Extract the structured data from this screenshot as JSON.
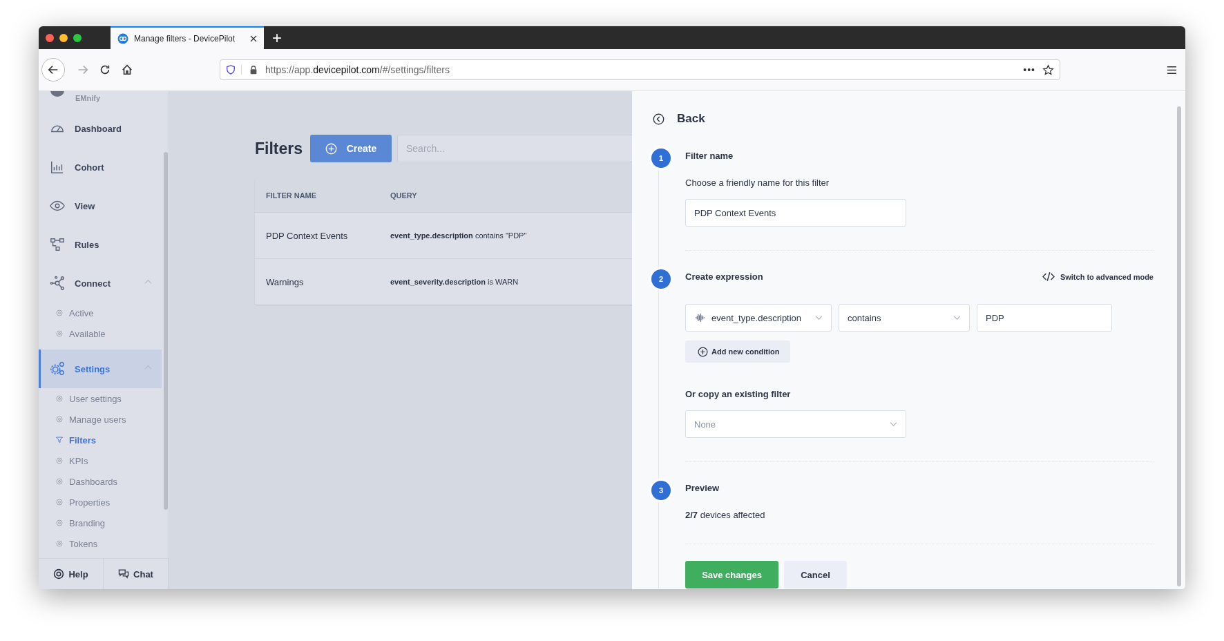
{
  "browser": {
    "tab_title": "Manage filters - DevicePilot",
    "new_tab": "+",
    "url": {
      "prefix": "https://app.",
      "domain": "devicepilot.com",
      "path": "/#/settings/filters"
    },
    "page_actions": "•••"
  },
  "sidebar": {
    "account": "EMnify",
    "items": [
      {
        "label": "Dashboard",
        "selected": false
      },
      {
        "label": "Cohort",
        "selected": false
      },
      {
        "label": "View",
        "selected": false
      },
      {
        "label": "Rules",
        "selected": false
      },
      {
        "label": "Connect",
        "selected": false,
        "expanded": true,
        "children": [
          {
            "label": "Active",
            "selected": false
          },
          {
            "label": "Available",
            "selected": false
          }
        ]
      },
      {
        "label": "Settings",
        "selected": true,
        "expanded": true,
        "children": [
          {
            "label": "User settings",
            "selected": false
          },
          {
            "label": "Manage users",
            "selected": false
          },
          {
            "label": "Filters",
            "selected": true
          },
          {
            "label": "KPIs",
            "selected": false
          },
          {
            "label": "Dashboards",
            "selected": false
          },
          {
            "label": "Properties",
            "selected": false
          },
          {
            "label": "Branding",
            "selected": false
          },
          {
            "label": "Tokens",
            "selected": false
          }
        ]
      }
    ],
    "footer": [
      "Help",
      "Chat"
    ]
  },
  "main": {
    "title": "Filters",
    "create_button": "Create",
    "search": {
      "placeholder": "Search..."
    },
    "table": {
      "columns": [
        "FILTER NAME",
        "QUERY"
      ],
      "rows": [
        {
          "name": "PDP Context Events",
          "query": "**event_type.description** contains \"PDP\""
        },
        {
          "name": "Warnings",
          "query": "**event_severity.description** is WARN"
        }
      ]
    }
  },
  "panel": {
    "back": "Back",
    "step_1": {
      "number": "1",
      "title": "Filter name",
      "description": "Choose a friendly name for this filter",
      "name_field": {
        "value": "PDP Context Events"
      }
    },
    "step_2": {
      "number": "2",
      "title": "Create expression",
      "advanced_mode": "Switch to advanced mode",
      "condition": {
        "field": "event_type.description",
        "operator": "contains",
        "value": "PDP"
      },
      "add_condition": "Add new condition",
      "copy_label": "Or copy an existing filter",
      "copy_select": {
        "placeholder": "None"
      }
    },
    "step_3": {
      "number": "3",
      "title": "Preview",
      "summary": "**2/7** devices affected"
    },
    "buttons": {
      "save": "Save changes",
      "cancel": "Cancel"
    }
  }
}
